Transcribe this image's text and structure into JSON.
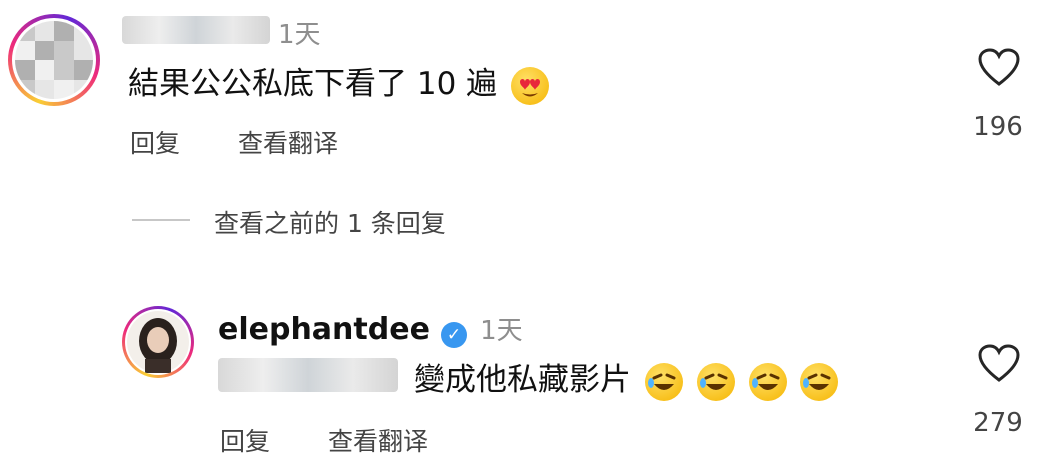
{
  "comment1": {
    "time": "1天",
    "text": "結果公公私底下看了 10 遍",
    "emoji": "heart-eyes-emoji",
    "reply_label": "回复",
    "translate_label": "查看翻译",
    "like_count": "196"
  },
  "view_replies": {
    "label": "查看之前的 1 条回复"
  },
  "comment2": {
    "username": "elephantdee",
    "time": "1天",
    "text": "變成他私藏影片",
    "emojis": [
      "rofl-emoji",
      "rofl-emoji",
      "rofl-emoji",
      "rofl-emoji"
    ],
    "reply_label": "回复",
    "translate_label": "查看翻译",
    "like_count": "279"
  },
  "colors": {
    "verified": "#3897f0",
    "secondary_text": "#8e8e8e"
  }
}
